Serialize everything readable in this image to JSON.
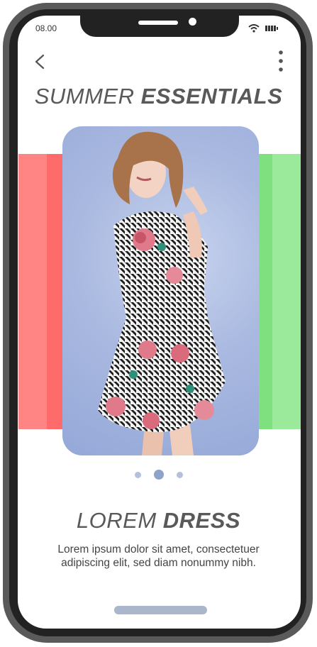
{
  "status_bar": {
    "time": "08.00"
  },
  "header": {
    "title_light": "SUMMER",
    "title_bold": "ESSENTIALS"
  },
  "carousel": {
    "slides": 3,
    "active_index": 1,
    "left_accent": "#ff7b7b",
    "right_accent": "#92e592"
  },
  "product": {
    "name_light": "LOREM",
    "name_bold": "DRESS",
    "description": "Lorem ipsum dolor sit amet, consectetuer adipiscing elit, sed diam nonummy nibh."
  },
  "icons": {
    "back": "chevron-left-icon",
    "menu": "more-vertical-icon",
    "wifi": "wifi-icon",
    "battery": "battery-icon"
  }
}
